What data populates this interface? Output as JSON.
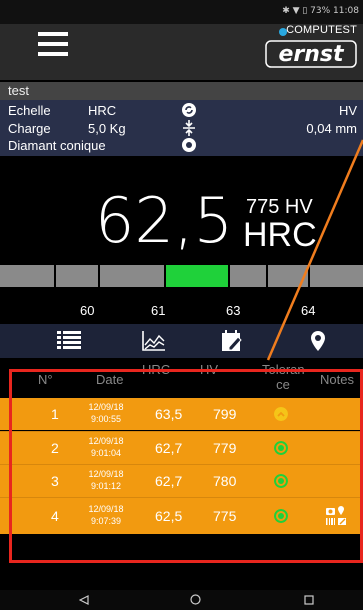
{
  "status_bar": {
    "icons_text": "✱ ▼ ▯ 73% 11:08"
  },
  "app": {
    "brand": "COMPUTEST",
    "logo_text": "ernst"
  },
  "test": {
    "title": "test"
  },
  "info": {
    "echelle_label": "Echelle",
    "echelle_value": "HRC",
    "echelle_alt": "HV",
    "charge_label": "Charge",
    "charge_value": "5,0 Kg",
    "charge_alt": "0,04 mm",
    "indenter_label": "Diamant conique"
  },
  "reading": {
    "value": "62,5",
    "hv": "775 HV",
    "unit": "HRC"
  },
  "scale": {
    "ticks": [
      "60",
      "61",
      "63",
      "64"
    ],
    "marker_position": 0.45
  },
  "toolbar": {
    "icons": [
      "list-icon",
      "chart-icon",
      "calendar-edit-icon",
      "location-icon"
    ]
  },
  "table": {
    "headers": {
      "n": "N°",
      "date": "Date",
      "hrc": "HRC",
      "hv": "HV",
      "tol": "Toleran ce",
      "notes": "Notes"
    },
    "rows": [
      {
        "n": "1",
        "date": "12/09/18",
        "time": "9:00:55",
        "hrc": "63,5",
        "hv": "799",
        "tol": "warn"
      },
      {
        "n": "2",
        "date": "12/09/18",
        "time": "9:01:04",
        "hrc": "62,7",
        "hv": "779",
        "tol": "ok"
      },
      {
        "n": "3",
        "date": "12/09/18",
        "time": "9:01:12",
        "hrc": "62,7",
        "hv": "780",
        "tol": "ok"
      },
      {
        "n": "4",
        "date": "12/09/18",
        "time": "9:07:39",
        "hrc": "62,5",
        "hv": "775",
        "tol": "ok",
        "notes": true
      }
    ]
  },
  "colors": {
    "row": "#f29a10",
    "ok": "#1fd13a",
    "warn": "#f5c518",
    "highlight": "#e8261e",
    "pointer": "#f07d1e"
  }
}
